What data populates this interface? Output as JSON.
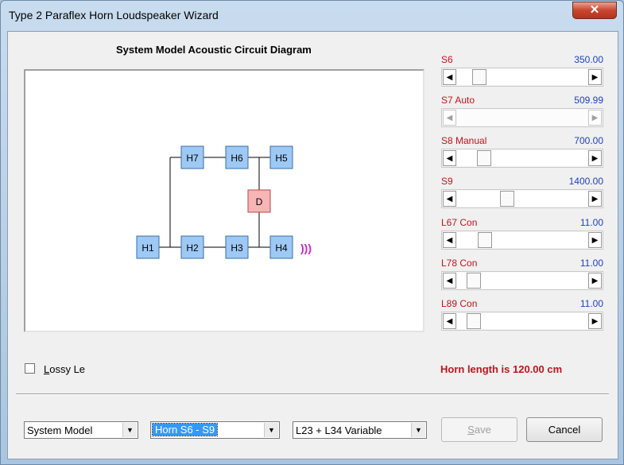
{
  "window": {
    "title": "Type 2 Paraflex Horn Loudspeaker Wizard",
    "close_glyph": "✕"
  },
  "diagram": {
    "title": "System Model Acoustic Circuit Diagram",
    "nodes": [
      {
        "id": "H7",
        "label": "H7",
        "kind": "horn"
      },
      {
        "id": "H6",
        "label": "H6",
        "kind": "horn"
      },
      {
        "id": "H5",
        "label": "H5",
        "kind": "horn"
      },
      {
        "id": "D",
        "label": "D",
        "kind": "driver"
      },
      {
        "id": "H1",
        "label": "H1",
        "kind": "horn"
      },
      {
        "id": "H2",
        "label": "H2",
        "kind": "horn"
      },
      {
        "id": "H3",
        "label": "H3",
        "kind": "horn"
      },
      {
        "id": "H4",
        "label": "H4",
        "kind": "horn"
      }
    ],
    "sound_symbol": ")))",
    "colors": {
      "horn_fill": "#9ec9f5",
      "horn_border": "#3a6ea5",
      "driver_fill": "#f7b5b5",
      "driver_border": "#b54a4a",
      "sound": "#cc22cc"
    }
  },
  "sliders": [
    {
      "label": "S6",
      "value": "350.00",
      "level": 0.13,
      "disabled": false
    },
    {
      "label": "S7  Auto",
      "value": "509.99",
      "level": 0.0,
      "disabled": true
    },
    {
      "label": "S8  Manual",
      "value": "700.00",
      "level": 0.17,
      "disabled": false
    },
    {
      "label": "S9",
      "value": "1400.00",
      "level": 0.37,
      "disabled": false
    },
    {
      "label": "L67  Con",
      "value": "11.00",
      "level": 0.18,
      "disabled": false
    },
    {
      "label": "L78  Con",
      "value": "11.00",
      "level": 0.08,
      "disabled": false
    },
    {
      "label": "L89  Con",
      "value": "11.00",
      "level": 0.08,
      "disabled": false
    }
  ],
  "checkbox": {
    "label_underlined": "L",
    "label_rest": "ossy Le",
    "checked": false
  },
  "status": "Horn length is 120.00 cm",
  "combos": {
    "model": "System Model",
    "horn": "Horn S6 - S9",
    "variable": "L23 + L34 Variable"
  },
  "buttons": {
    "save_u": "S",
    "save_rest": "ave",
    "cancel": "Cancel"
  }
}
